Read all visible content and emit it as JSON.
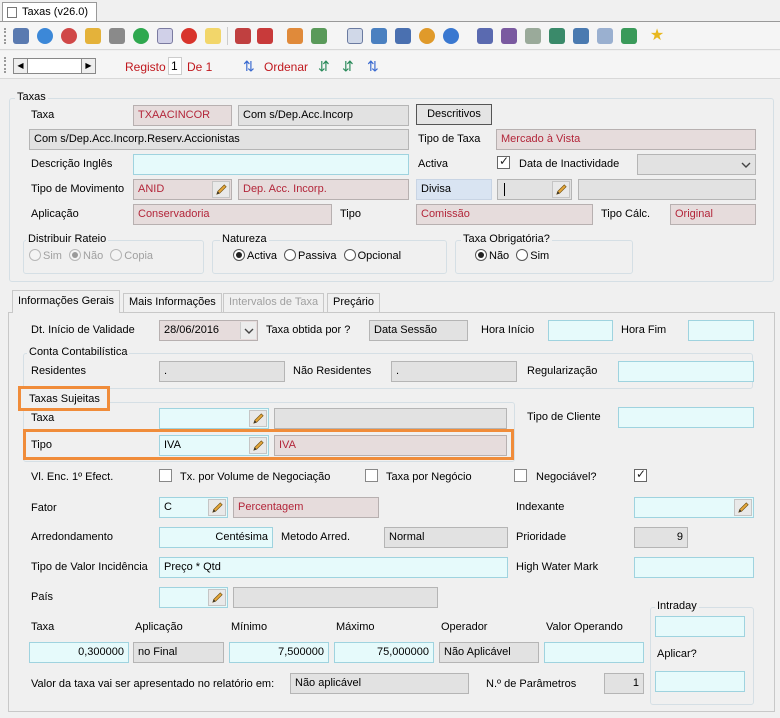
{
  "window": {
    "tab_title": "Taxas (v26.0)"
  },
  "toolbar": {
    "icons": [
      "save-icon",
      "refresh-icon",
      "undo-icon",
      "group-icon",
      "print-icon",
      "add-icon",
      "copy-icon",
      "delete-icon",
      "note-icon",
      "export-icon",
      "filter-icon",
      "users-icon",
      "download-icon",
      "calendar-icon",
      "list-icon",
      "edit-icon",
      "settings-icon",
      "help-icon",
      "people-icon",
      "book-icon",
      "document-icon",
      "card-icon",
      "sheet-icon",
      "window-icon",
      "import-icon",
      "star-icon"
    ]
  },
  "nav": {
    "registo_label": "Registo",
    "registo_value": "1",
    "de_label": "De 1",
    "ordenar_label": "Ordenar"
  },
  "taxas_group": {
    "title": "Taxas",
    "taxa_label": "Taxa",
    "taxa_code": "TXAACINCOR",
    "taxa_short": "Com s/Dep.Acc.Incorp",
    "descritivos_button": "Descritivos",
    "long_description": "Com s/Dep.Acc.Incorp.Reserv.Accionistas",
    "tipo_taxa_label": "Tipo de Taxa",
    "tipo_taxa_value": "Mercado à Vista",
    "descricao_ingles_label": "Descrição Inglês",
    "descricao_ingles_value": "",
    "activa_label": "Activa",
    "data_inactividade_label": "Data de Inactividade",
    "tipo_movimento_label": "Tipo de Movimento",
    "tipo_movimento_code": "ANID",
    "tipo_movimento_desc": "Dep. Acc. Incorp.",
    "divisa_label": "Divisa",
    "aplicacao_label": "Aplicação",
    "aplicacao_value": "Conservadoria",
    "tipo_label": "Tipo",
    "tipo_value": "Comissão",
    "tipo_calc_label": "Tipo Cálc.",
    "tipo_calc_value": "Original",
    "distribuir_title": "Distribuir Rateio",
    "distribuir_options": [
      "Sim",
      "Não",
      "Copia"
    ],
    "natureza_title": "Natureza",
    "natureza_options": [
      "Activa",
      "Passiva",
      "Opcional"
    ],
    "obrigatoria_title": "Taxa Obrigatória?",
    "obrigatoria_options": [
      "Não",
      "Sim"
    ]
  },
  "tabs": [
    "Informações Gerais",
    "Mais Informações",
    "Intervalos de Taxa",
    "Preçário"
  ],
  "geral": {
    "dt_inicio_label": "Dt. Início de Validade",
    "dt_inicio_value": "28/06/2016",
    "taxa_obtida_label": "Taxa obtida por ?",
    "taxa_obtida_value": "Data Sessão",
    "hora_inicio_label": "Hora Início",
    "hora_fim_label": "Hora Fim",
    "conta_title": "Conta Contabilística",
    "residentes_label": "Residentes",
    "residentes_value": ".",
    "nao_residentes_label": "Não Residentes",
    "nao_residentes_value": ".",
    "regularizacao_label": "Regularização",
    "taxas_sujeitas_title": "Taxas Sujeitas",
    "ts_taxa_label": "Taxa",
    "ts_tipo_label": "Tipo",
    "ts_tipo_code": "IVA",
    "ts_tipo_desc": "IVA",
    "tipo_cliente_label": "Tipo de Cliente",
    "vl_enc_label": "Vl. Enc. 1º Efect.",
    "tx_volume_label": "Tx. por Volume de Negociação",
    "taxa_negocio_label": "Taxa por Negócio",
    "negociavel_label": "Negociável?",
    "fator_label": "Fator",
    "fator_code": "C",
    "fator_desc": "Percentagem",
    "indexante_label": "Indexante",
    "arredondamento_label": "Arredondamento",
    "arredondamento_value": "Centésima",
    "metodo_label": "Metodo Arred.",
    "metodo_value": "Normal",
    "prioridade_label": "Prioridade",
    "prioridade_value": "9",
    "valor_incidencia_label": "Tipo de Valor Incidência",
    "valor_incidencia_value": "Preço * Qtd",
    "high_water_label": "High Water Mark",
    "pais_label": "País",
    "col_taxa": "Taxa",
    "col_aplicacao": "Aplicação",
    "col_minimo": "Mínimo",
    "col_maximo": "Máximo",
    "col_operador": "Operador",
    "col_valor_operando": "Valor Operando",
    "row_taxa": "0,300000",
    "row_aplicacao": "no Final",
    "row_minimo": "7,500000",
    "row_maximo": "75,000000",
    "row_operador": "Não Aplicável",
    "intraday_title": "Intraday",
    "aplicar_label": "Aplicar?",
    "valor_apresentado_label": "Valor da taxa vai ser apresentado no relatório em:",
    "valor_apresentado_value": "Não aplicável",
    "parametros_label": "N.º de Parâmetros",
    "parametros_value": "1"
  },
  "colors": {
    "accent_highlight": "#f08c3a",
    "pink_field": "#e6dcdc",
    "pink_text": "#b3263a",
    "cyan_field": "#e6fafb"
  }
}
